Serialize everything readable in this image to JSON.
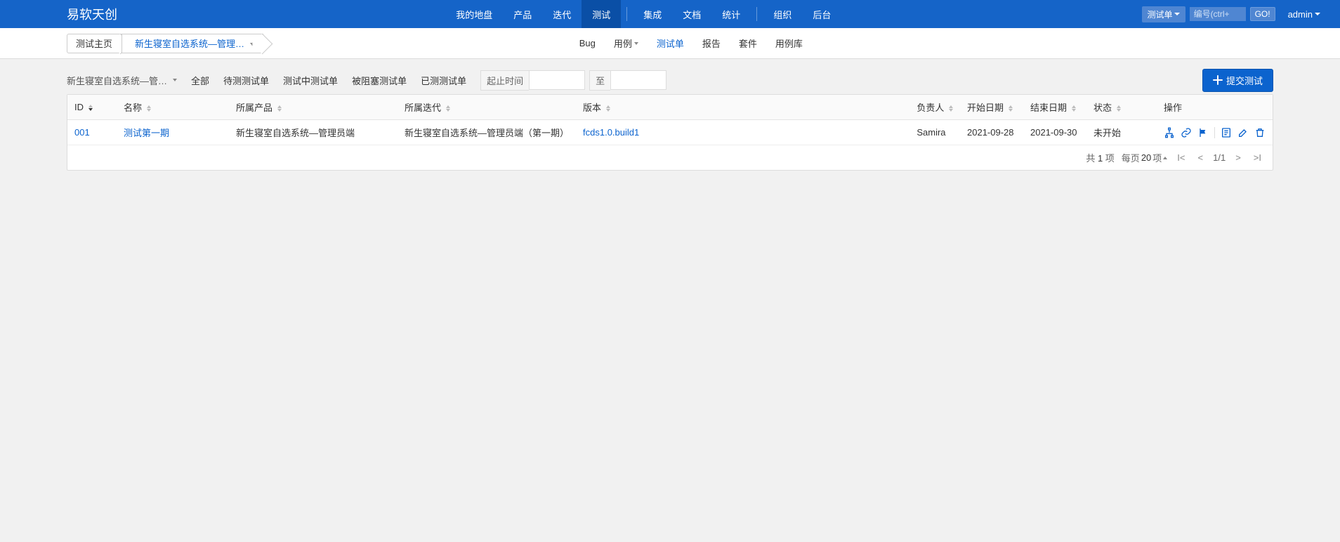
{
  "brand": "易软天创",
  "topnav": {
    "items": [
      {
        "label": "我的地盘"
      },
      {
        "label": "产品"
      },
      {
        "label": "迭代"
      },
      {
        "label": "测试",
        "active": true
      },
      {
        "label": "集成"
      },
      {
        "label": "文档"
      },
      {
        "label": "统计"
      },
      {
        "label": "组织"
      },
      {
        "label": "后台"
      }
    ]
  },
  "search": {
    "type_label": "测试单",
    "placeholder": "编号(ctrl+",
    "go_label": "GO!"
  },
  "user": {
    "name": "admin"
  },
  "breadcrumb": {
    "home": "测试主页",
    "current": "新生寝室自选系统—管理…"
  },
  "subnav": {
    "items": [
      {
        "label": "Bug"
      },
      {
        "label": "用例",
        "caret": true
      },
      {
        "label": "测试单",
        "active": true
      },
      {
        "label": "报告"
      },
      {
        "label": "套件"
      },
      {
        "label": "用例库"
      }
    ]
  },
  "filter": {
    "project_truncated": "新生寝室自选系统—管…",
    "tabs": {
      "all": "全部",
      "pending": "待测测试单",
      "testing": "测试中测试单",
      "blocked": "被阻塞测试单",
      "done": "已测测试单"
    },
    "start_label": "起止时间",
    "to_label": "至",
    "start_value": "",
    "end_value": ""
  },
  "submit_label": "提交测试",
  "columns": {
    "id": "ID",
    "name": "名称",
    "product": "所属产品",
    "iteration": "所属迭代",
    "version_": "版本",
    "owner": "负责人",
    "start": "开始日期",
    "end": "结束日期",
    "status": "状态",
    "actions": "操作"
  },
  "rows": [
    {
      "id": "001",
      "name": "测试第一期",
      "product": "新生寝室自选系统—管理员端",
      "iteration": "新生寝室自选系统—管理员端（第一期）",
      "version_": "fcds1.0.build1",
      "owner": "Samira",
      "start": "2021-09-28",
      "end": "2021-09-30",
      "status": "未开始"
    }
  ],
  "pager": {
    "total_prefix": "共 ",
    "total_count": "1",
    "total_suffix": " 项",
    "perpage_prefix": "每页 ",
    "perpage_count": "20",
    "perpage_suffix": " 项",
    "page_text": "1/1"
  }
}
